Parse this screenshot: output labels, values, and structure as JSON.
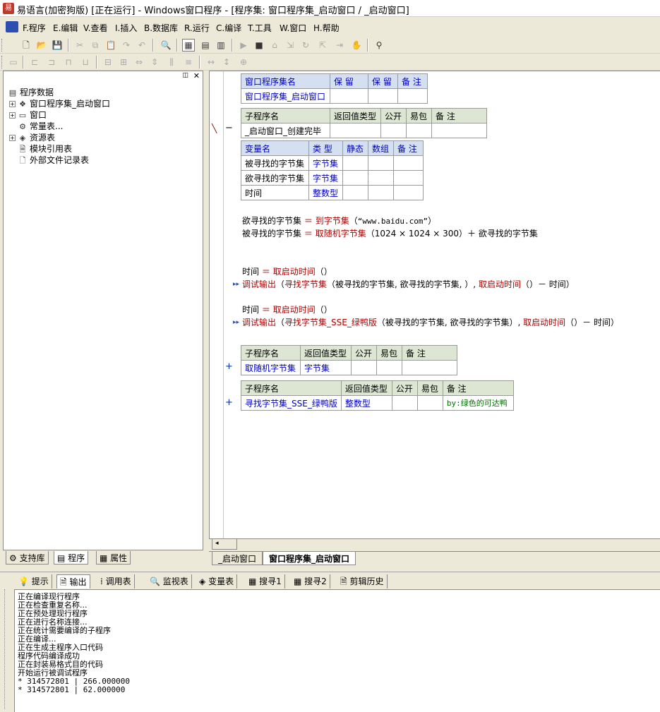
{
  "window": {
    "title": "易语言(加密狗版) [正在运行] - Windows窗口程序 - [程序集: 窗口程序集_启动窗口 / _启动窗口]"
  },
  "menu": [
    "F.程序",
    "E.编辑",
    "V.查看",
    "I.插入",
    "B.数据库",
    "R.运行",
    "C.编译",
    "T.工具",
    "W.窗口",
    "H.帮助"
  ],
  "tree": {
    "root": "程序数据",
    "items": [
      "窗口程序集_启动窗口",
      "窗口",
      "常量表...",
      "资源表",
      "模块引用表",
      "外部文件记录表"
    ]
  },
  "left_tabs": [
    "支持库",
    "程序",
    "属性"
  ],
  "assembly_table": {
    "headers": [
      "窗口程序集名",
      "保 留",
      "保 留",
      "备 注"
    ],
    "row": [
      "窗口程序集_启动窗口",
      "",
      "",
      ""
    ]
  },
  "sub_table_1": {
    "headers": [
      "子程序名",
      "返回值类型",
      "公开",
      "易包",
      "备 注"
    ],
    "row": [
      "_启动窗口_创建完毕",
      "",
      "",
      "",
      ""
    ]
  },
  "var_table": {
    "headers": [
      "变量名",
      "类 型",
      "静态",
      "数组",
      "备 注"
    ],
    "rows": [
      [
        "被寻找的字节集",
        "字节集",
        "",
        "",
        ""
      ],
      [
        "欲寻找的字节集",
        "字节集",
        "",
        "",
        ""
      ],
      [
        "时间",
        "整数型",
        "",
        "",
        ""
      ]
    ]
  },
  "code": {
    "l1a": "欲寻找的字节集",
    "l1b": "＝",
    "l1c": "到字节集",
    "l1d": "（",
    "l1e": "“www.baidu.com”",
    "l1f": "）",
    "l2a": "被寻找的字节集",
    "l2b": "＝",
    "l2c": "取随机字节集",
    "l2d": "（1024 × 1024 × 300）＋ 欲寻找的字节集",
    "l3a": "时间",
    "l3b": "＝",
    "l3c": "取启动时间",
    "l3d": "（）",
    "l4a": "调试输出",
    "l4b": "（",
    "l4c": "寻找字节集",
    "l4d": "（被寻找的字节集, 欲寻找的字节集, ）,",
    "l4e": "取启动时间",
    "l4f": "（）－ 时间）",
    "l5a": "时间",
    "l5b": "＝",
    "l5c": "取启动时间",
    "l5d": "（）",
    "l6a": "调试输出",
    "l6b": "（",
    "l6c": "寻找字节集_SSE_绿鸭版",
    "l6d": "（被寻找的字节集, 欲寻找的字节集）,",
    "l6e": "取启动时间",
    "l6f": "（）－ 时间）"
  },
  "sub_table_2": {
    "headers": [
      "子程序名",
      "返回值类型",
      "公开",
      "易包",
      "备 注"
    ],
    "row": [
      "取随机字节集",
      "字节集",
      "",
      "",
      ""
    ]
  },
  "sub_table_3": {
    "headers": [
      "子程序名",
      "返回值类型",
      "公开",
      "易包",
      "备 注"
    ],
    "row": [
      "寻找字节集_SSE_绿鸭版",
      "整数型",
      "",
      "",
      "by:绿色的可达鸭"
    ]
  },
  "code_tabs": [
    "_启动窗口",
    "窗口程序集_启动窗口"
  ],
  "output_tabs": [
    "提示",
    "输出",
    "调用表",
    "监视表",
    "变量表",
    "搜寻1",
    "搜寻2",
    "剪辑历史"
  ],
  "output_lines": [
    "正在编译现行程序",
    "正在检查重复名称...",
    "正在预处理现行程序",
    "正在进行名称连接...",
    "正在统计需要编译的子程序",
    "正在编译...",
    "正在生成主程序入口代码",
    "程序代码编译成功",
    "正在封装易格式目的代码",
    "开始运行被调试程序",
    "* 314572801 | 266.000000",
    "* 314572801 | 62.000000"
  ]
}
